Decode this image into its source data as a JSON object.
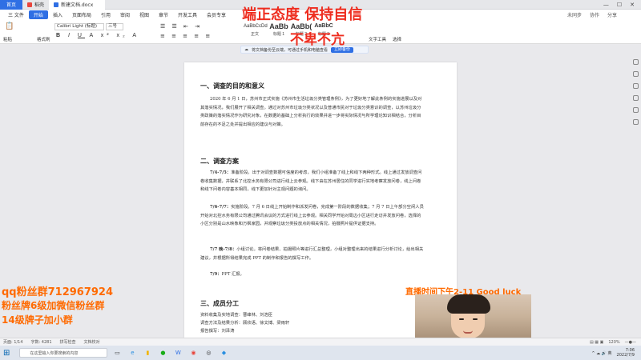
{
  "tabs": {
    "home": "首页",
    "t1": "稻壳",
    "doc": "新建文档.docx"
  },
  "menu": {
    "items": [
      "三 文件",
      "开始",
      "插入",
      "页面布局",
      "引用",
      "审阅",
      "视图",
      "章节",
      "开发工具",
      "会员专享"
    ],
    "active_index": 1,
    "right": [
      "未同步",
      "协作",
      "分享"
    ]
  },
  "ribbon": {
    "font_name": "Calibri Light (标题)",
    "font_size": "三号",
    "left_groups": [
      "粘贴",
      "格式刷"
    ],
    "styles": [
      {
        "sample": "AaBbCcDd",
        "label": "正文"
      },
      {
        "sample": "AaBb",
        "label": "标题 1"
      },
      {
        "sample": "AaBb(",
        "label": "标题 2"
      },
      {
        "sample": "AaBbC",
        "label": "标题 3"
      }
    ],
    "right_items": [
      "文字工具",
      "选择"
    ]
  },
  "notice": {
    "text": "将文档备份至云端，可通过手机和电脑查看",
    "button": "立即备份"
  },
  "overlay": {
    "top_line1": "端正态度 保持自信",
    "top_line2": "不卑不亢",
    "left_line1": "qq粉丝群712967924",
    "left_line2": "粉丝牌6级加微信粉丝群",
    "left_line3": "14级牌子加小群",
    "right_line": "直播时间下午2-11 Good luck"
  },
  "document": {
    "h1": "一、调查的目的和意义",
    "p1": "2020 年 6 月 1 日，苏州市正式实施《苏州市生活垃圾分类管理条例》，为了更好地了解此条例的实施进展以及对其落实情况，我们展开了相关调查。通过对苏州市垃圾分类状况以及普通市民对于垃圾分类意识的调查，以苏州垃圾分类政策的落实情况作为研究对象，在数据的基础上分析执行的效果并进一步将实际情况与所学理论知识相结合，分析目前存在的不足之处并提出相应的建议与对策。",
    "h2": "二、调查方案",
    "p2_lead": "7/4-7/5：",
    "p2": "准备阶段。出于对调查数据可信度的考虑，我们小组准备了线上和线下两种形式。线上通过发放调查问卷收集数据，并联系了北控水务有限公司进行线上云参观。线下由在苏州居住的同学进行实地考察发放问卷，线上问卷和线下问卷内容基本相同，线下更加针对主观问题的询问。",
    "p3_lead": "7/6-7/7：",
    "p3": "实施阶段。7 月 6 日线上开始制作和派发问卷，完成第一阶段的数据收集；7 月 7 日上午部分空闲人员开始对北控水务有限公司通过腾讯会议的方式进行线上云参观。相关同学开始对周边小区进行走访并发放问卷，选择的小区分别是山水映象和万枫家园，并观察垃圾分类投放点的相关情况，拍摄照片提供证据支持。",
    "p4_lead": "7/7 晚-7/8：",
    "p4": "小组讨论。将问卷结果、拍摄照片等进行汇总整理，小组对整理出来的结果进行分析讨论，给出相关建议，并根据所得结果完成 PPT 的制作和报告的撰写工作。",
    "p5_lead": "7/9：",
    "p5": "PPT 汇报。",
    "h3": "三、成员分工",
    "l1": "资料收集及实地调查：曹峰林、刘浩臣",
    "l2": "调查方法及结果分析：顾欣语、徐文博、梁雨轩",
    "l3": "报告撰写：刘泽涛"
  },
  "statusbar": {
    "page": "页面: 1/14",
    "words": "字数: 4281",
    "spell": "拼写检查",
    "doc": "文档校对",
    "zoom": "120%"
  },
  "taskbar": {
    "search_placeholder": "在这里输入你要搜索的内容",
    "time": "7:06",
    "date": "2022/7/9"
  }
}
